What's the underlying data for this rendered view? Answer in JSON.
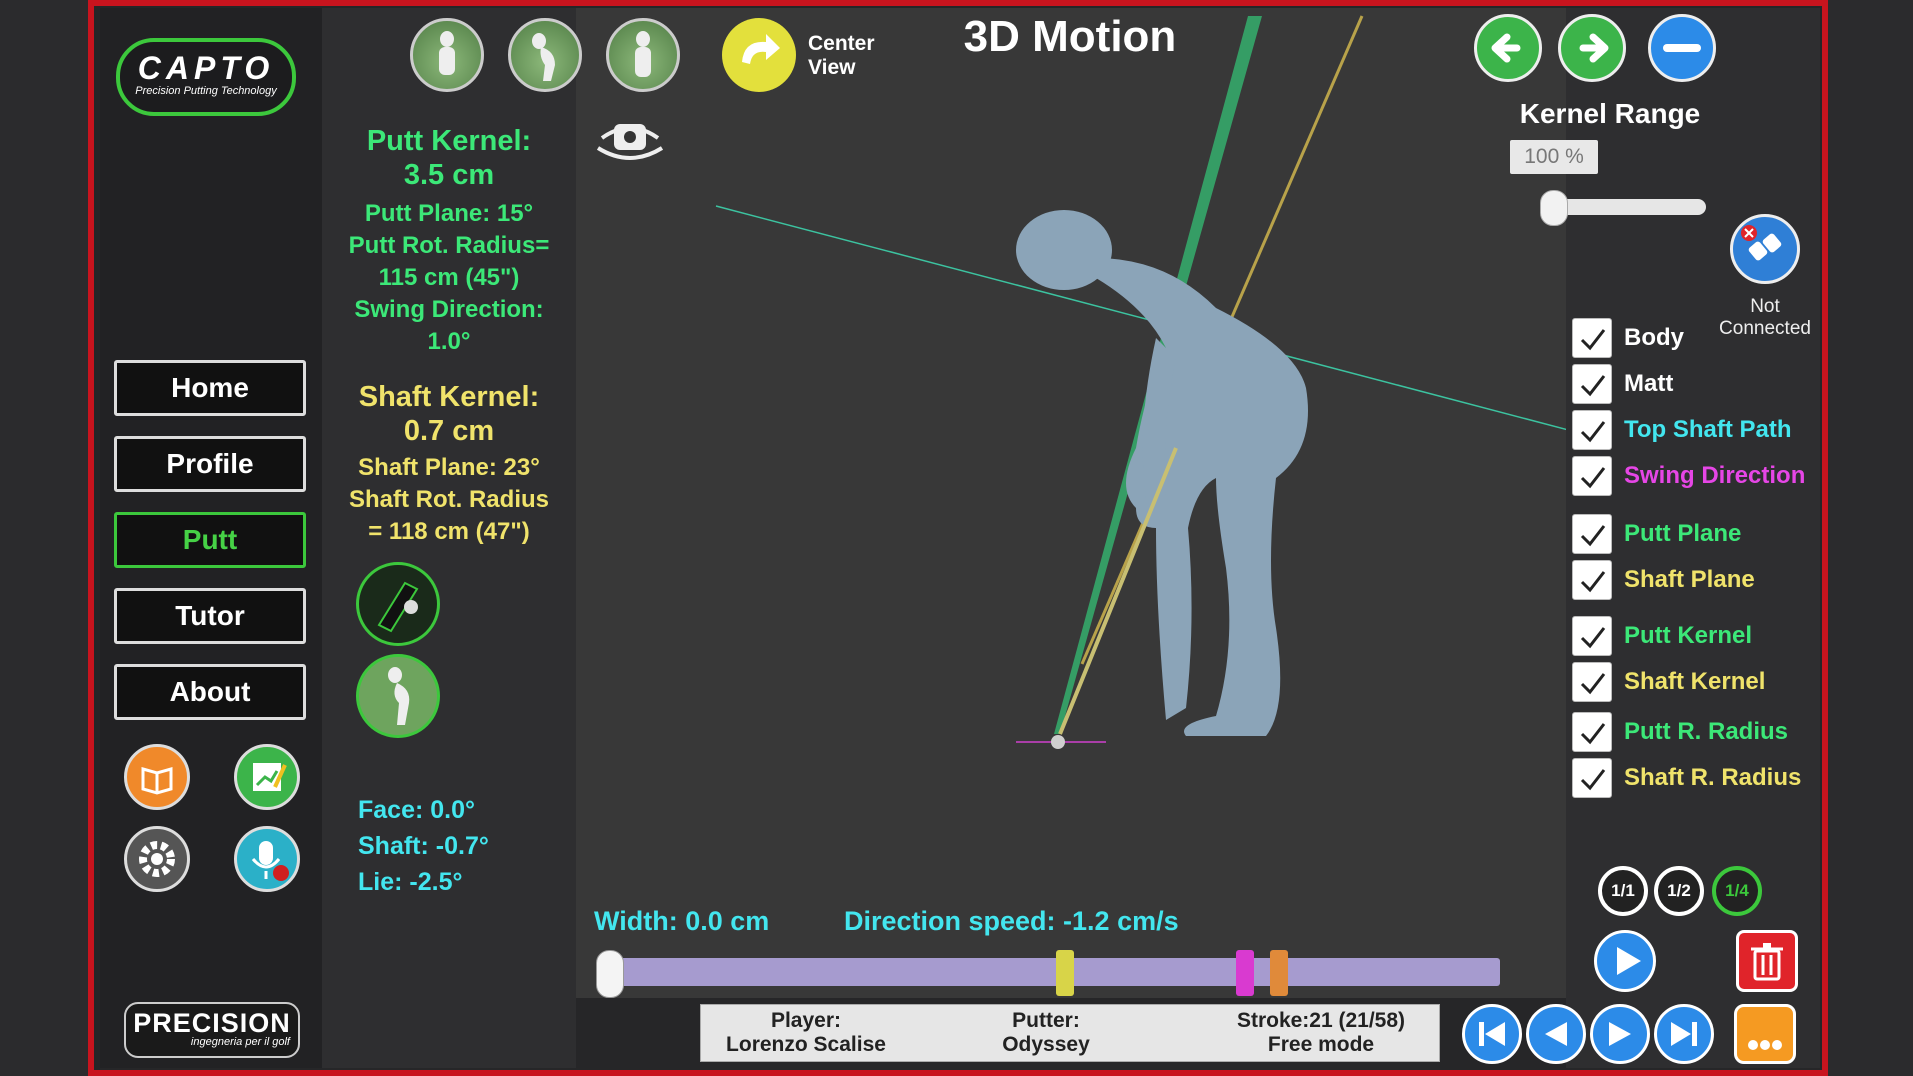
{
  "logo": {
    "brand": "CAPTO",
    "tagline": "Precision Putting Technology"
  },
  "nav": {
    "home": "Home",
    "profile": "Profile",
    "putt": "Putt",
    "tutor": "Tutor",
    "about": "About"
  },
  "sidebar_icons": [
    "book-icon",
    "chart-edit-icon",
    "gear-icon",
    "microphone-rec-icon"
  ],
  "footer_logo": {
    "brand": "PRECISION",
    "tagline": "ingegneria per il golf"
  },
  "header": {
    "title": "3D Motion",
    "center_view": [
      "Center",
      "View"
    ]
  },
  "putt_metrics": {
    "kernel_title": "Putt Kernel:",
    "kernel_value": "3.5 cm",
    "plane": "Putt Plane: 15°",
    "rot_radius_1": "Putt Rot. Radius=",
    "rot_radius_2": "115 cm  (45\")",
    "swing_dir_1": "Swing Direction:",
    "swing_dir_2": "1.0°"
  },
  "shaft_metrics": {
    "kernel_title": "Shaft Kernel:",
    "kernel_value": "0.7 cm",
    "plane": "Shaft Plane: 23°",
    "rot_radius_1": "Shaft Rot. Radius",
    "rot_radius_2": "= 118 cm  (47\")"
  },
  "face_metrics": {
    "face": "Face: 0.0°",
    "shaft": "Shaft: -0.7°",
    "lie": "Lie: -2.5°"
  },
  "kernel_range": {
    "label": "Kernel Range",
    "value": "100 %",
    "slider_fraction": 0.0
  },
  "connection": {
    "line1": "Not",
    "line2": "Connected"
  },
  "layers": [
    {
      "label": "Body",
      "checked": true,
      "color": "#ffffff"
    },
    {
      "label": "Matt",
      "checked": true,
      "color": "#ffffff"
    },
    {
      "label": "Top Shaft Path",
      "checked": true,
      "color": "#43e6ef"
    },
    {
      "label": "Swing Direction",
      "checked": true,
      "color": "#e646e6"
    },
    {
      "label": "Putt Plane",
      "checked": true,
      "color": "#3ce878"
    },
    {
      "label": "Shaft Plane",
      "checked": true,
      "color": "#f0e36b"
    },
    {
      "label": "Putt Kernel",
      "checked": true,
      "color": "#3ce878"
    },
    {
      "label": "Shaft Kernel",
      "checked": true,
      "color": "#f0e36b"
    },
    {
      "label": "Putt R. Radius",
      "checked": true,
      "color": "#3ce878"
    },
    {
      "label": "Shaft R. Radius",
      "checked": true,
      "color": "#f0e36b"
    }
  ],
  "speed": {
    "full": "1/1",
    "half": "1/2",
    "quarter": "1/4",
    "selected": "1/4"
  },
  "stroke_stats": {
    "width": "Width: 0.0 cm",
    "direction_speed": "Direction speed: -1.2 cm/s"
  },
  "timeline": {
    "position_fraction": 0.0
  },
  "info": {
    "player_label": "Player:",
    "player": "Lorenzo Scalise",
    "putter_label": "Putter:",
    "putter": "Odyssey",
    "stroke_label": "Stroke:21 (21/58)",
    "mode": "Free mode"
  }
}
